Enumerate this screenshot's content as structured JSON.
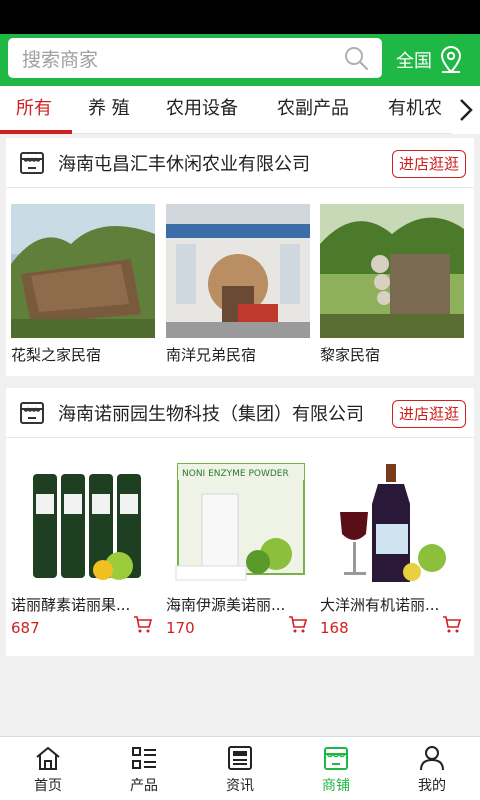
{
  "search": {
    "placeholder": "搜索商家"
  },
  "region": {
    "label": "全国"
  },
  "tabs": [
    {
      "label": "所有",
      "active": true
    },
    {
      "label": "养 殖",
      "active": false
    },
    {
      "label": "农用设备",
      "active": false
    },
    {
      "label": "农副产品",
      "active": false
    },
    {
      "label": "有机农",
      "active": false
    }
  ],
  "shops": [
    {
      "name": "海南屯昌汇丰休闲农业有限公司",
      "visit_label": "进店逛逛",
      "items": [
        {
          "title": "花梨之家民宿"
        },
        {
          "title": "南洋兄弟民宿"
        },
        {
          "title": "黎家民宿"
        }
      ]
    },
    {
      "name": "海南诺丽园生物科技（集团）有限公司",
      "visit_label": "进店逛逛",
      "items": [
        {
          "title": "诺丽酵素诺丽果...",
          "price": "687"
        },
        {
          "title": "海南伊源美诺丽...",
          "price": "170"
        },
        {
          "title": "大洋洲有机诺丽...",
          "price": "168"
        }
      ]
    }
  ],
  "product_box_text": "NONI ENZYME POWDER",
  "bottom_nav": [
    {
      "label": "首页",
      "icon": "home-icon",
      "active": false
    },
    {
      "label": "产品",
      "icon": "list-icon",
      "active": false
    },
    {
      "label": "资讯",
      "icon": "news-icon",
      "active": false
    },
    {
      "label": "商铺",
      "icon": "shop-icon",
      "active": true
    },
    {
      "label": "我的",
      "icon": "user-icon",
      "active": false
    }
  ],
  "colors": {
    "brand_green": "#1fb845",
    "accent_red": "#d02020"
  }
}
